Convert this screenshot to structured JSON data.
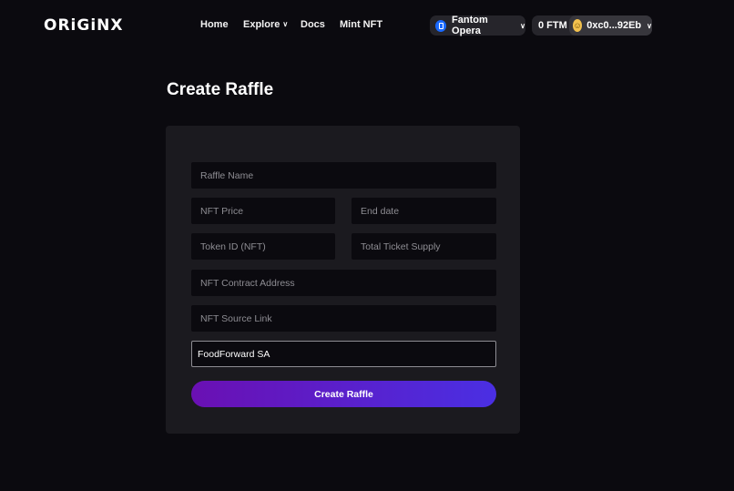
{
  "brand": {
    "logo": "ORiGiNX"
  },
  "nav": {
    "items": [
      {
        "label": "Home"
      },
      {
        "label": "Explore"
      },
      {
        "label": "Docs"
      },
      {
        "label": "Mint NFT"
      }
    ]
  },
  "network": {
    "label": "Fantom Opera",
    "icon": "fantom-logo-icon",
    "color": "#1969ff"
  },
  "account": {
    "balance": "0 FTM",
    "address": "0xc0...92Eb",
    "avatar": "emoji-face"
  },
  "page": {
    "title": "Create Raffle"
  },
  "form": {
    "raffle_name": {
      "placeholder": "Raffle Name",
      "value": ""
    },
    "nft_price": {
      "placeholder": "NFT Price",
      "value": ""
    },
    "end_date": {
      "placeholder": "End date",
      "value": ""
    },
    "token_id": {
      "placeholder": "Token ID (NFT)",
      "value": ""
    },
    "ticket_supply": {
      "placeholder": "Total Ticket Supply",
      "value": ""
    },
    "contract_address": {
      "placeholder": "NFT Contract Address",
      "value": ""
    },
    "source_link": {
      "placeholder": "NFT Source Link",
      "value": ""
    },
    "charity": {
      "value": "FoodForward SA"
    },
    "submit_label": "Create Raffle"
  },
  "colors": {
    "background": "#0b0a0f",
    "card": "#1b1a1f",
    "accent_start": "#6a10b3",
    "accent_end": "#4a2fe3"
  }
}
